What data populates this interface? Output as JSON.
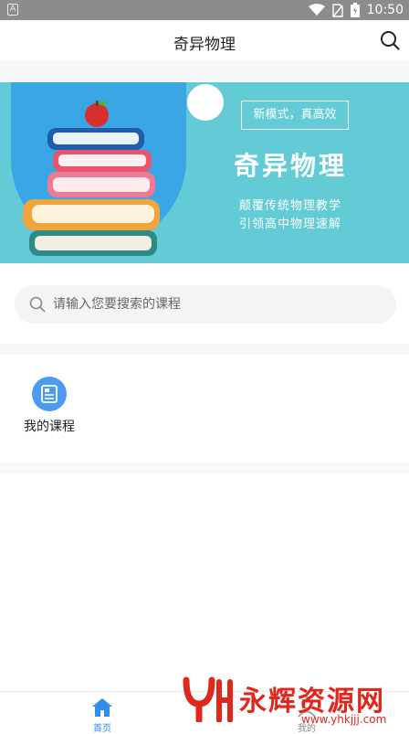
{
  "status_bar": {
    "left_icon_letter": "A",
    "time": "10:50"
  },
  "header": {
    "title": "奇异物理",
    "search_icon": "search-icon"
  },
  "banner": {
    "tag": "新模式，真高效",
    "title": "奇异物理",
    "subtitle_line1": "颠覆传统物理教学",
    "subtitle_line2": "引领高中物理速解",
    "colors": {
      "background": "#63cbd6",
      "blob": "#3aa6e6"
    }
  },
  "search": {
    "placeholder": "请输入您要搜索的课程",
    "value": ""
  },
  "menu": {
    "items": [
      {
        "label": "我的课程",
        "icon": "course-icon"
      }
    ]
  },
  "tabbar": {
    "tabs": [
      {
        "label": "首页",
        "icon": "home-icon",
        "active": true
      },
      {
        "label": "我的",
        "icon": "user-icon",
        "active": false
      }
    ],
    "active_color": "#2f8ff0"
  },
  "watermark": {
    "text": "永辉资源网",
    "url": "www.yhkjjj.com"
  }
}
